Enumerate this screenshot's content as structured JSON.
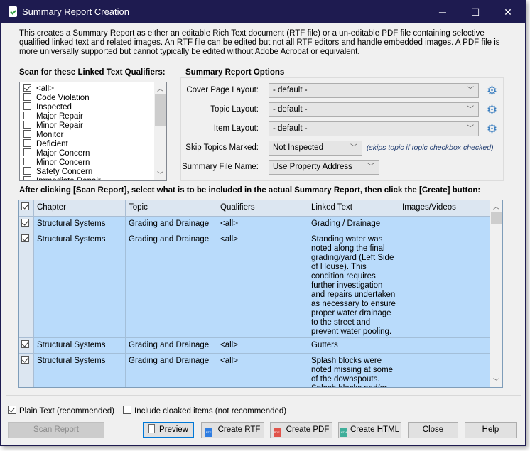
{
  "window": {
    "title": "Summary Report Creation",
    "minimize": "─",
    "maximize": "☐",
    "close": "✕"
  },
  "description": "This creates a Summary Report as either an editable Rich Text document (RTF file)  or a un-editable PDF file containing selective qualified linked text and related images.  An RTF file can be edited but not all RTF editors and handle embedded images.  A PDF file is more universally supported but cannot typically be edited without Adobe Acrobat or equivalent.",
  "qualifiers": {
    "label": "Scan for these Linked Text Qualifiers:",
    "items": [
      {
        "label": "<all>",
        "checked": true
      },
      {
        "label": "Code Violation",
        "checked": false
      },
      {
        "label": "Inspected",
        "checked": false
      },
      {
        "label": "Major Repair",
        "checked": false
      },
      {
        "label": "Minor Repair",
        "checked": false
      },
      {
        "label": "Monitor",
        "checked": false
      },
      {
        "label": "Deficient",
        "checked": false
      },
      {
        "label": "Major Concern",
        "checked": false
      },
      {
        "label": "Minor Concern",
        "checked": false
      },
      {
        "label": "Safety Concern",
        "checked": false
      },
      {
        "label": "Immediate Repair",
        "checked": false
      }
    ]
  },
  "options": {
    "title": "Summary Report Options",
    "cover_label": "Cover Page Layout:",
    "cover_value": "- default -",
    "topic_label": "Topic Layout:",
    "topic_value": "- default -",
    "item_label": "Item Layout:",
    "item_value": "- default -",
    "skip_label": "Skip Topics Marked:",
    "skip_value": "Not Inspected",
    "skip_hint": "(skips topic if topic checkbox checked)",
    "filename_label": "Summary File Name:",
    "filename_value": "Use Property Address"
  },
  "table": {
    "instruction": "After clicking [Scan Report], select what is to be included in the actual Summary Report, then click the [Create] button:",
    "columns": [
      "Chapter",
      "Topic",
      "Qualifiers",
      "Linked Text",
      "Images/Videos"
    ],
    "rows": [
      {
        "checked": true,
        "chapter": "Structural Systems",
        "topic": "Grading and Drainage",
        "qualifiers": "<all>",
        "text": "Grading / Drainage",
        "images": ""
      },
      {
        "checked": true,
        "chapter": "Structural Systems",
        "topic": "Grading and Drainage",
        "qualifiers": "<all>",
        "text": "Standing water was noted along the final grading/yard (Left Side of House).  This condition requires further investigation and repairs undertaken as necessary to ensure proper water drainage to the street and prevent water pooling.",
        "images": ""
      },
      {
        "checked": true,
        "chapter": "Structural Systems",
        "topic": "Grading and Drainage",
        "qualifiers": "<all>",
        "text": "Gutters",
        "images": ""
      },
      {
        "checked": true,
        "chapter": "Structural Systems",
        "topic": "Grading and Drainage",
        "qualifiers": "<all>",
        "text": "Splash blocks were noted missing at some of the downspouts. Splash blocks and/or",
        "images": ""
      }
    ]
  },
  "footer": {
    "plain_text": "Plain Text (recommended)",
    "plain_checked": true,
    "cloaked": "Include cloaked items (not recommended)",
    "cloaked_checked": false,
    "scan": "Scan Report",
    "preview": "Preview",
    "rtf": "Create RTF",
    "pdf": "Create PDF",
    "html": "Create HTML",
    "close": "Close",
    "help": "Help",
    "rtf_icon": "RTF",
    "pdf_icon": "PDF",
    "html_icon": "HTM"
  },
  "colors": {
    "titlebar": "#1e1b50",
    "row": "#b9dbfb",
    "header": "#dce6f1",
    "focus": "#0078d7"
  }
}
